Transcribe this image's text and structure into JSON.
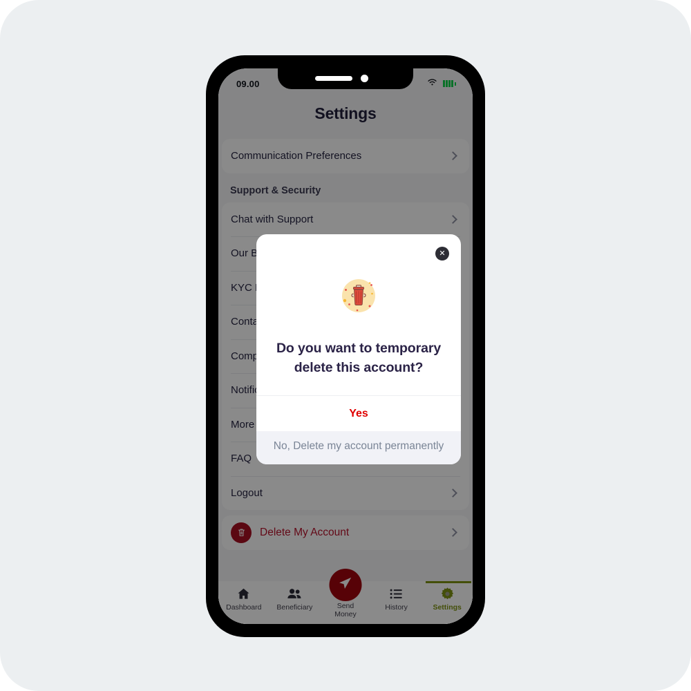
{
  "status_bar": {
    "time": "09.00",
    "wifi_icon": "wifi-icon",
    "battery_icon": "battery-icon"
  },
  "header": {
    "title": "Settings"
  },
  "settings": {
    "top_card": [
      {
        "label": "Communication Preferences",
        "chevron": "chevron-right-icon"
      }
    ],
    "section_title": "Support & Security",
    "support_items": [
      {
        "label": "Chat with Support",
        "chevron": "chevron-right-icon"
      },
      {
        "label": "Our Branches",
        "chevron": "chevron-right-icon"
      },
      {
        "label": "KYC Documents",
        "chevron": "chevron-right-icon"
      },
      {
        "label": "Contact Us",
        "chevron": "chevron-right-icon"
      },
      {
        "label": "Compliance",
        "chevron": "chevron-right-icon"
      },
      {
        "label": "Notifications",
        "chevron": "chevron-right-icon"
      },
      {
        "label": "More Options",
        "chevron": "chevron-right-icon"
      },
      {
        "label": "FAQ",
        "chevron": "chevron-right-icon"
      },
      {
        "label": "Logout",
        "chevron": "chevron-right-icon"
      }
    ],
    "delete_row": {
      "label": "Delete My Account",
      "icon": "trash-icon",
      "chevron": "chevron-right-icon",
      "color": "#b8122b",
      "badge_color": "#a90f22"
    }
  },
  "modal": {
    "close_label": "✕",
    "close_icon": "close-icon",
    "illustration_icon": "trash-can-illustration",
    "title": "Do you want to temporary delete this account?",
    "confirm_label": "Yes",
    "confirm_color": "#e00000",
    "dismiss_label": "No, Delete my account permanently",
    "dismiss_color": "#7a8596"
  },
  "bottom_nav": {
    "items": [
      {
        "label": "Dashboard",
        "icon": "home-icon",
        "active": false
      },
      {
        "label": "Beneficiary",
        "icon": "people-icon",
        "active": false
      },
      {
        "label": "History",
        "icon": "list-icon",
        "active": false
      },
      {
        "label": "Settings",
        "icon": "gear-icon",
        "active": true
      }
    ],
    "center": {
      "label_line1": "Send",
      "label_line2": "Money",
      "icon": "paper-plane-icon",
      "color": "#a1040e"
    },
    "active_color": "#7e9312"
  },
  "colors": {
    "page_background": "#eceff1",
    "accent_green": "#7e9312",
    "danger_red": "#a1040e",
    "text_dark": "#2b2347"
  }
}
